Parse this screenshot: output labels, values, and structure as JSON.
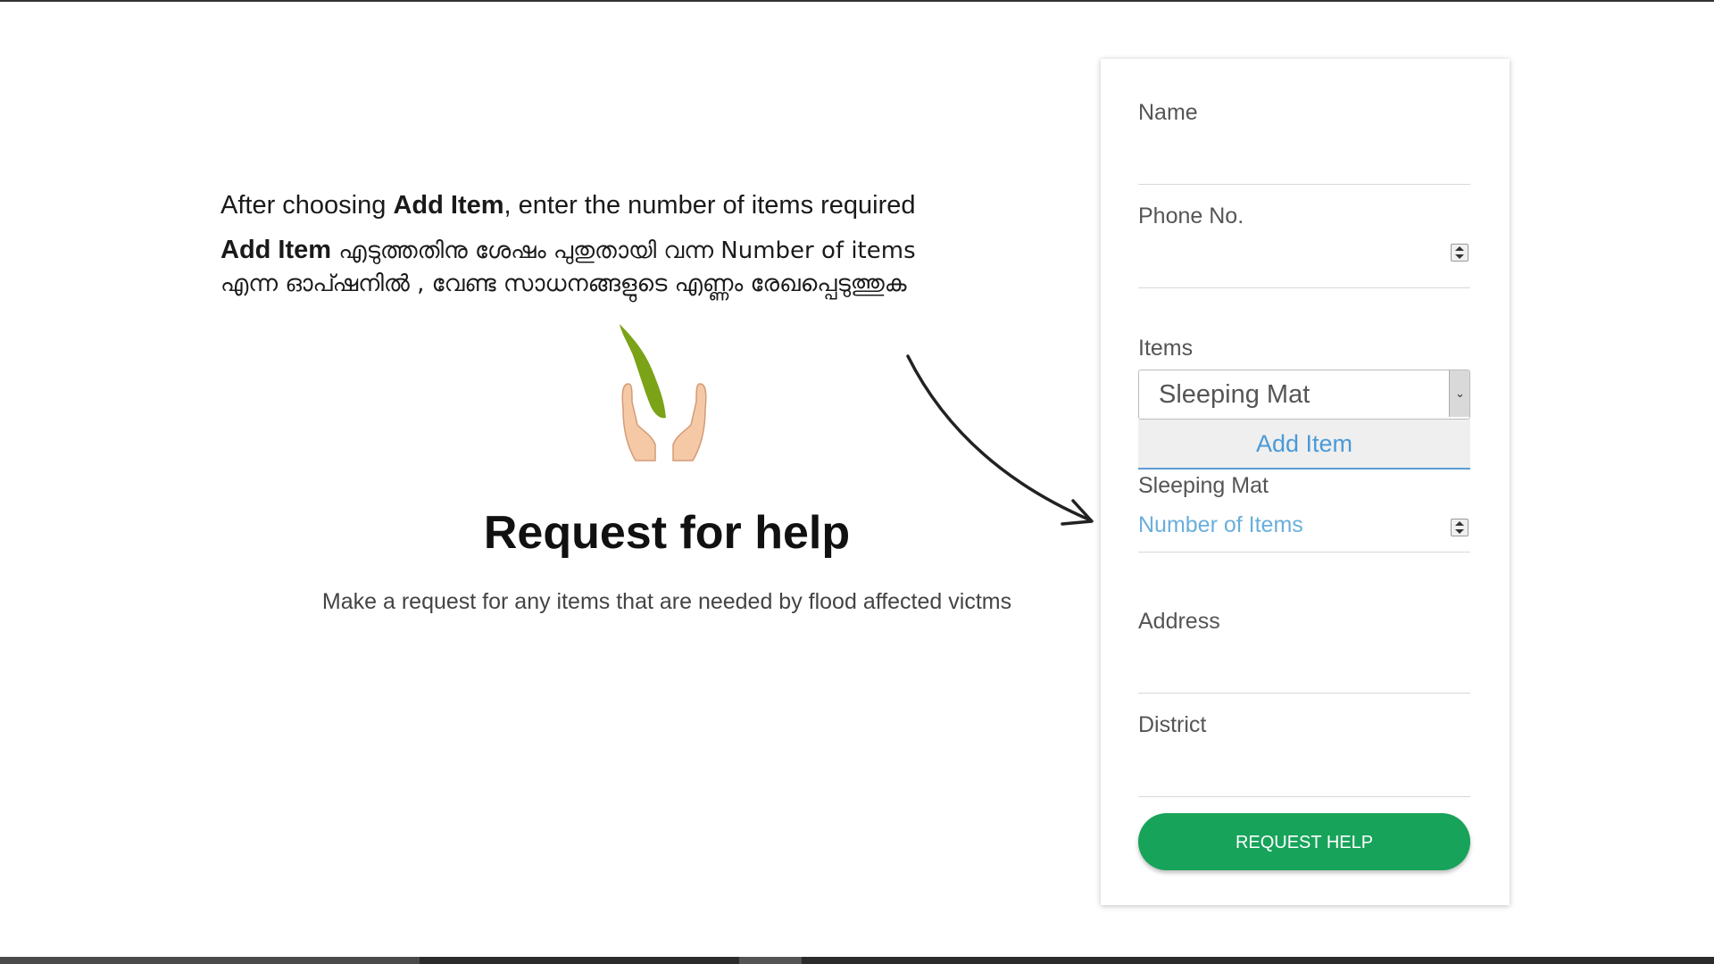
{
  "instructions": {
    "english_prefix": "After choosing ",
    "english_bold": "Add Item",
    "english_suffix": ", enter the number of items required",
    "malayalam_bold": "Add Item",
    "malayalam_line1": " എടുത്തതിനു ശേഷം പുതുതായി വന്ന Number of items",
    "malayalam_line2": "എന്ന ഓപ്ഷനിൽ  , വേണ്ട സാധനങ്ങളുടെ എണ്ണം രേഖപ്പെടുത്തുക"
  },
  "hero": {
    "title": "Request for help",
    "subtitle": "Make a request for any items that are needed by flood affected victms"
  },
  "form": {
    "name_label": "Name",
    "phone_label": "Phone No.",
    "items_label": "Items",
    "items_selected": "Sleeping Mat",
    "add_item_label": "Add Item",
    "added_item_label": "Sleeping Mat",
    "number_placeholder": "Number of Items",
    "address_label": "Address",
    "district_label": "District",
    "submit_label": "REQUEST HELP"
  },
  "colors": {
    "accent_green": "#17a35a",
    "link_blue": "#4a9ad8",
    "leaf_green": "#7aa317"
  },
  "icons": [
    "kerala-hands-logo-icon",
    "arrow-icon",
    "spinner-icon",
    "chevron-down-icon"
  ]
}
